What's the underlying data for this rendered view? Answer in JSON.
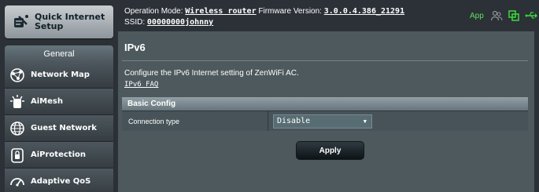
{
  "sidebar": {
    "quick_setup_label": "Quick Internet Setup",
    "section_title": "General",
    "items": [
      {
        "label": "Network Map",
        "icon": "network-map-icon"
      },
      {
        "label": "AiMesh",
        "icon": "aimesh-icon"
      },
      {
        "label": "Guest Network",
        "icon": "globe-icon"
      },
      {
        "label": "AiProtection",
        "icon": "lock-shield-icon"
      },
      {
        "label": "Adaptive QoS",
        "icon": "gauge-icon"
      }
    ]
  },
  "banner": {
    "op_mode_label": "Operation Mode:",
    "op_mode_value": "Wireless router",
    "firmware_label": "Firmware Version:",
    "firmware_value": "3.0.0.4.386_21291",
    "ssid_label": "SSID:",
    "ssid_value": "00000000johnny",
    "app_label": "App",
    "status_icons": [
      "users-icon",
      "copy-status-icon",
      "usb-icon"
    ]
  },
  "main": {
    "title": "IPv6",
    "description": "Configure the IPv6 Internet setting of ZenWiFi AC.",
    "faq_link": "IPv6 FAQ",
    "table": {
      "header": "Basic Config",
      "rows": [
        {
          "label": "Connection type",
          "value": "Disable"
        }
      ]
    },
    "apply_label": "Apply"
  },
  "colors": {
    "accent_green": "#5fe05f",
    "content_bg": "#4d595d",
    "page_bg": "#2b3136"
  }
}
